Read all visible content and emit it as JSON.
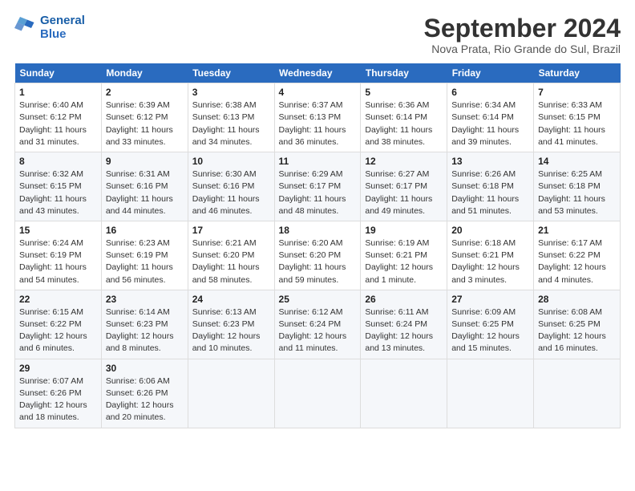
{
  "header": {
    "logo_line1": "General",
    "logo_line2": "Blue",
    "month": "September 2024",
    "location": "Nova Prata, Rio Grande do Sul, Brazil"
  },
  "weekdays": [
    "Sunday",
    "Monday",
    "Tuesday",
    "Wednesday",
    "Thursday",
    "Friday",
    "Saturday"
  ],
  "weeks": [
    [
      {
        "day": "1",
        "sunrise": "Sunrise: 6:40 AM",
        "sunset": "Sunset: 6:12 PM",
        "daylight": "Daylight: 11 hours and 31 minutes."
      },
      {
        "day": "2",
        "sunrise": "Sunrise: 6:39 AM",
        "sunset": "Sunset: 6:12 PM",
        "daylight": "Daylight: 11 hours and 33 minutes."
      },
      {
        "day": "3",
        "sunrise": "Sunrise: 6:38 AM",
        "sunset": "Sunset: 6:13 PM",
        "daylight": "Daylight: 11 hours and 34 minutes."
      },
      {
        "day": "4",
        "sunrise": "Sunrise: 6:37 AM",
        "sunset": "Sunset: 6:13 PM",
        "daylight": "Daylight: 11 hours and 36 minutes."
      },
      {
        "day": "5",
        "sunrise": "Sunrise: 6:36 AM",
        "sunset": "Sunset: 6:14 PM",
        "daylight": "Daylight: 11 hours and 38 minutes."
      },
      {
        "day": "6",
        "sunrise": "Sunrise: 6:34 AM",
        "sunset": "Sunset: 6:14 PM",
        "daylight": "Daylight: 11 hours and 39 minutes."
      },
      {
        "day": "7",
        "sunrise": "Sunrise: 6:33 AM",
        "sunset": "Sunset: 6:15 PM",
        "daylight": "Daylight: 11 hours and 41 minutes."
      }
    ],
    [
      {
        "day": "8",
        "sunrise": "Sunrise: 6:32 AM",
        "sunset": "Sunset: 6:15 PM",
        "daylight": "Daylight: 11 hours and 43 minutes."
      },
      {
        "day": "9",
        "sunrise": "Sunrise: 6:31 AM",
        "sunset": "Sunset: 6:16 PM",
        "daylight": "Daylight: 11 hours and 44 minutes."
      },
      {
        "day": "10",
        "sunrise": "Sunrise: 6:30 AM",
        "sunset": "Sunset: 6:16 PM",
        "daylight": "Daylight: 11 hours and 46 minutes."
      },
      {
        "day": "11",
        "sunrise": "Sunrise: 6:29 AM",
        "sunset": "Sunset: 6:17 PM",
        "daylight": "Daylight: 11 hours and 48 minutes."
      },
      {
        "day": "12",
        "sunrise": "Sunrise: 6:27 AM",
        "sunset": "Sunset: 6:17 PM",
        "daylight": "Daylight: 11 hours and 49 minutes."
      },
      {
        "day": "13",
        "sunrise": "Sunrise: 6:26 AM",
        "sunset": "Sunset: 6:18 PM",
        "daylight": "Daylight: 11 hours and 51 minutes."
      },
      {
        "day": "14",
        "sunrise": "Sunrise: 6:25 AM",
        "sunset": "Sunset: 6:18 PM",
        "daylight": "Daylight: 11 hours and 53 minutes."
      }
    ],
    [
      {
        "day": "15",
        "sunrise": "Sunrise: 6:24 AM",
        "sunset": "Sunset: 6:19 PM",
        "daylight": "Daylight: 11 hours and 54 minutes."
      },
      {
        "day": "16",
        "sunrise": "Sunrise: 6:23 AM",
        "sunset": "Sunset: 6:19 PM",
        "daylight": "Daylight: 11 hours and 56 minutes."
      },
      {
        "day": "17",
        "sunrise": "Sunrise: 6:21 AM",
        "sunset": "Sunset: 6:20 PM",
        "daylight": "Daylight: 11 hours and 58 minutes."
      },
      {
        "day": "18",
        "sunrise": "Sunrise: 6:20 AM",
        "sunset": "Sunset: 6:20 PM",
        "daylight": "Daylight: 11 hours and 59 minutes."
      },
      {
        "day": "19",
        "sunrise": "Sunrise: 6:19 AM",
        "sunset": "Sunset: 6:21 PM",
        "daylight": "Daylight: 12 hours and 1 minute."
      },
      {
        "day": "20",
        "sunrise": "Sunrise: 6:18 AM",
        "sunset": "Sunset: 6:21 PM",
        "daylight": "Daylight: 12 hours and 3 minutes."
      },
      {
        "day": "21",
        "sunrise": "Sunrise: 6:17 AM",
        "sunset": "Sunset: 6:22 PM",
        "daylight": "Daylight: 12 hours and 4 minutes."
      }
    ],
    [
      {
        "day": "22",
        "sunrise": "Sunrise: 6:15 AM",
        "sunset": "Sunset: 6:22 PM",
        "daylight": "Daylight: 12 hours and 6 minutes."
      },
      {
        "day": "23",
        "sunrise": "Sunrise: 6:14 AM",
        "sunset": "Sunset: 6:23 PM",
        "daylight": "Daylight: 12 hours and 8 minutes."
      },
      {
        "day": "24",
        "sunrise": "Sunrise: 6:13 AM",
        "sunset": "Sunset: 6:23 PM",
        "daylight": "Daylight: 12 hours and 10 minutes."
      },
      {
        "day": "25",
        "sunrise": "Sunrise: 6:12 AM",
        "sunset": "Sunset: 6:24 PM",
        "daylight": "Daylight: 12 hours and 11 minutes."
      },
      {
        "day": "26",
        "sunrise": "Sunrise: 6:11 AM",
        "sunset": "Sunset: 6:24 PM",
        "daylight": "Daylight: 12 hours and 13 minutes."
      },
      {
        "day": "27",
        "sunrise": "Sunrise: 6:09 AM",
        "sunset": "Sunset: 6:25 PM",
        "daylight": "Daylight: 12 hours and 15 minutes."
      },
      {
        "day": "28",
        "sunrise": "Sunrise: 6:08 AM",
        "sunset": "Sunset: 6:25 PM",
        "daylight": "Daylight: 12 hours and 16 minutes."
      }
    ],
    [
      {
        "day": "29",
        "sunrise": "Sunrise: 6:07 AM",
        "sunset": "Sunset: 6:26 PM",
        "daylight": "Daylight: 12 hours and 18 minutes."
      },
      {
        "day": "30",
        "sunrise": "Sunrise: 6:06 AM",
        "sunset": "Sunset: 6:26 PM",
        "daylight": "Daylight: 12 hours and 20 minutes."
      },
      null,
      null,
      null,
      null,
      null
    ]
  ]
}
